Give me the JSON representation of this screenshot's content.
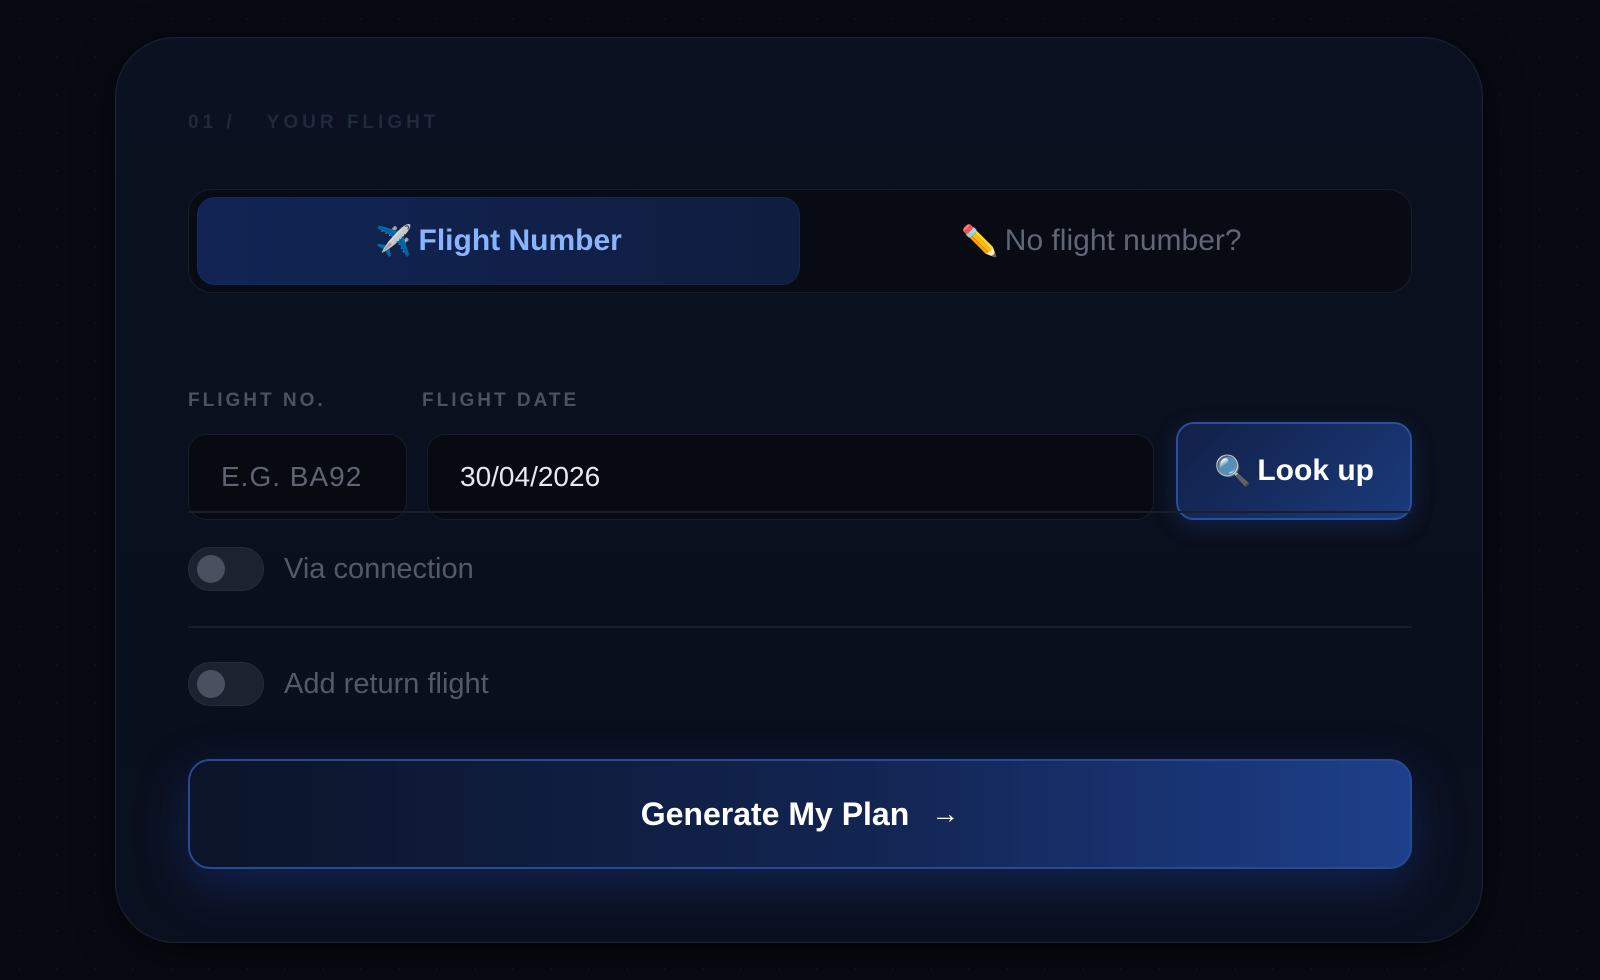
{
  "section": {
    "number": "01 /",
    "title": "YOUR FLIGHT"
  },
  "mode_toggle": {
    "active": {
      "icon": "airplane-icon",
      "icon_glyph": "✈️",
      "label": "Flight Number"
    },
    "inactive": {
      "icon": "pencil-icon",
      "icon_glyph": "✏️",
      "label": "No flight number?"
    }
  },
  "fields": {
    "flight_no": {
      "label": "FLIGHT NO.",
      "placeholder": "E.G. BA92",
      "value": ""
    },
    "flight_date": {
      "label": "FLIGHT DATE",
      "value": "30/04/2026"
    }
  },
  "lookup_button": {
    "icon": "magnifier-icon",
    "icon_glyph": "🔍",
    "label": "Look up"
  },
  "options": {
    "via_connection": {
      "label": "Via connection",
      "enabled": false
    },
    "return_flight": {
      "label": "Add return flight",
      "enabled": false
    }
  },
  "generate_button": {
    "label": "Generate My Plan",
    "arrow_glyph": "→",
    "icon": "arrow-right-icon"
  },
  "colors": {
    "accent": "#8bb4ff",
    "button_blue": "#1e3f8a",
    "background": "#070a12"
  }
}
